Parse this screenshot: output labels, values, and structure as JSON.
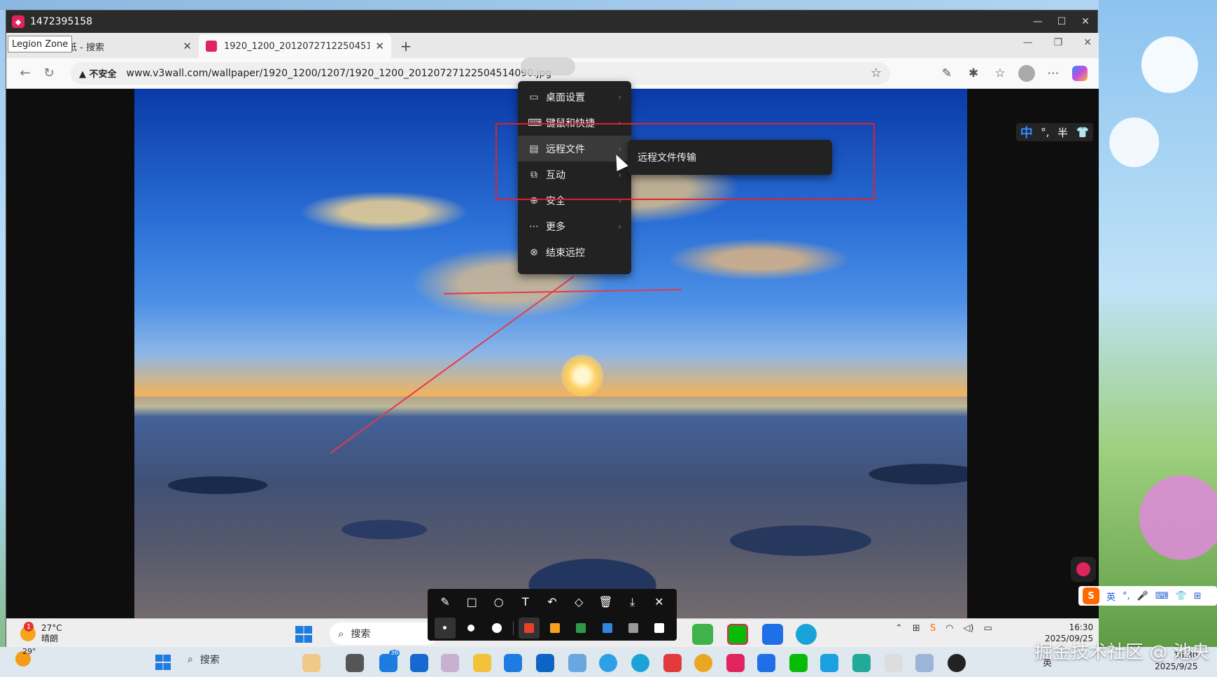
{
  "remote_window": {
    "title": "1472395158",
    "controls": [
      "—",
      "☐",
      "✕"
    ]
  },
  "browser": {
    "tooltip": "Legion Zone",
    "tabs": [
      {
        "label": "纸 - 搜索",
        "close": "✕"
      },
      {
        "label": "1920_1200_20120727122504514(",
        "close": "✕"
      }
    ],
    "new_tab": "+",
    "address": {
      "security_label": "不安全",
      "url": "www.v3wall.com/wallpaper/1920_1200/1207/1920_1200_20120727122504514090.jpg"
    }
  },
  "context_menu": {
    "items": [
      {
        "icon": "monitor-icon",
        "label": "桌面设置"
      },
      {
        "icon": "keyboard-icon",
        "label": "键鼠和快捷"
      },
      {
        "icon": "folder-icon",
        "label": "远程文件"
      },
      {
        "icon": "interact-icon",
        "label": "互动"
      },
      {
        "icon": "shield-icon",
        "label": "安全"
      },
      {
        "icon": "more-icon",
        "label": "更多"
      },
      {
        "icon": "close-circle-icon",
        "label": "结束远控"
      }
    ],
    "submenu_item": "远程文件传输",
    "highlighted_index": 2
  },
  "ime_bar": {
    "mode": "中",
    "punct": "°,",
    "width": "半",
    "skin": "👕"
  },
  "remote_taskbar": {
    "weather_temp": "27°C",
    "weather_desc": "晴朗",
    "weather_badge": "1",
    "search_label": "搜索",
    "clock_time": "16:30",
    "clock_date": "2025/09/25"
  },
  "annotation_toolbar": {
    "tools": [
      "pen",
      "rectangle",
      "circle",
      "text",
      "undo",
      "eraser",
      "delete",
      "download",
      "close"
    ],
    "text_tool_glyph": "T",
    "colors": [
      "#e8402a",
      "#f7a21b",
      "#2e9b48",
      "#2f86e0",
      "#9a9a9a",
      "#ffffff"
    ]
  },
  "sogou_bar": {
    "logo": "S",
    "lang": "英"
  },
  "host_taskbar": {
    "temp": "29°",
    "search_label": "搜索",
    "badge_count": "36",
    "clock_time": "16:30",
    "clock_date": "2025/9/25",
    "tray_lang": "英"
  },
  "watermark": "掘金技术社区 @ 池央"
}
